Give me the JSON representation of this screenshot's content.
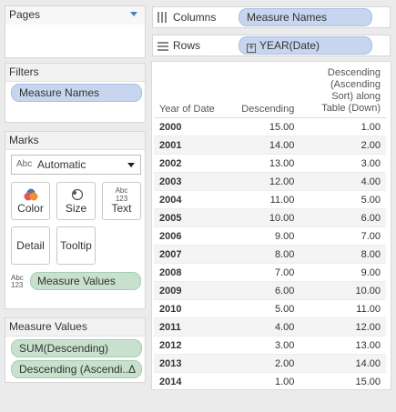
{
  "pages": {
    "title": "Pages"
  },
  "columns_shelf": {
    "label": "Columns",
    "pill": "Measure Names"
  },
  "rows_shelf": {
    "label": "Rows",
    "pill": "YEAR(Date)",
    "pill_prefix": "+"
  },
  "filters": {
    "title": "Filters",
    "pill": "Measure Names"
  },
  "marks": {
    "title": "Marks",
    "type_prefix": "Abc",
    "type": "Automatic",
    "buttons": [
      {
        "label": "Color",
        "icon": "color-icon"
      },
      {
        "label": "Size",
        "icon": "size-icon"
      },
      {
        "label": "Text",
        "icon": "text-icon"
      },
      {
        "label": "Detail",
        "icon": "detail-icon"
      },
      {
        "label": "Tooltip",
        "icon": "tooltip-icon"
      }
    ],
    "text_icon_abc": "Abc",
    "text_icon_num": "123",
    "pill": "Measure Values"
  },
  "measure_values": {
    "title": "Measure Values",
    "pills": [
      "SUM(Descending)",
      "Descending (Ascendi..",
      "Δ"
    ]
  },
  "table": {
    "headers": [
      "Year of Date",
      "Descending",
      "Descending\n(Ascending\nSort) along\nTable (Down)"
    ],
    "rows": [
      {
        "year": "2000",
        "descending": "15.00",
        "asc_sort": "1.00"
      },
      {
        "year": "2001",
        "descending": "14.00",
        "asc_sort": "2.00"
      },
      {
        "year": "2002",
        "descending": "13.00",
        "asc_sort": "3.00"
      },
      {
        "year": "2003",
        "descending": "12.00",
        "asc_sort": "4.00"
      },
      {
        "year": "2004",
        "descending": "11.00",
        "asc_sort": "5.00"
      },
      {
        "year": "2005",
        "descending": "10.00",
        "asc_sort": "6.00"
      },
      {
        "year": "2006",
        "descending": "9.00",
        "asc_sort": "7.00"
      },
      {
        "year": "2007",
        "descending": "8.00",
        "asc_sort": "8.00"
      },
      {
        "year": "2008",
        "descending": "7.00",
        "asc_sort": "9.00"
      },
      {
        "year": "2009",
        "descending": "6.00",
        "asc_sort": "10.00"
      },
      {
        "year": "2010",
        "descending": "5.00",
        "asc_sort": "11.00"
      },
      {
        "year": "2011",
        "descending": "4.00",
        "asc_sort": "12.00"
      },
      {
        "year": "2012",
        "descending": "3.00",
        "asc_sort": "13.00"
      },
      {
        "year": "2013",
        "descending": "2.00",
        "asc_sort": "14.00"
      },
      {
        "year": "2014",
        "descending": "1.00",
        "asc_sort": "15.00"
      }
    ]
  },
  "colors": {
    "dimension_pill": "#c7d6ee",
    "measure_pill": "#c8e1ce"
  }
}
